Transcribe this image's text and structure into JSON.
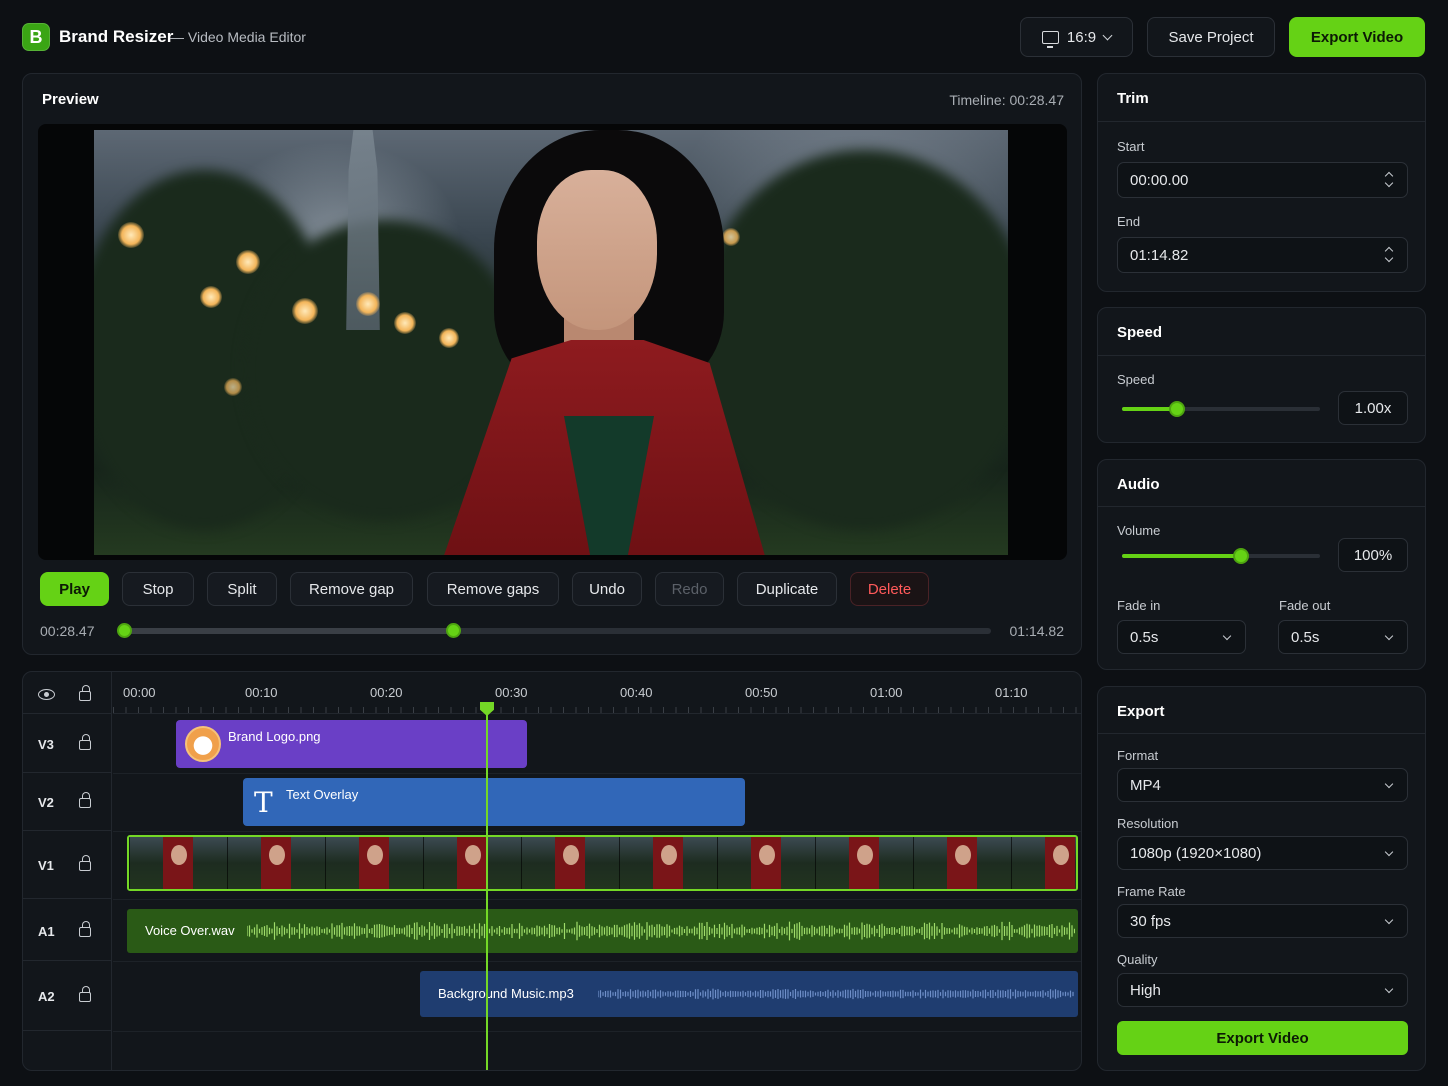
{
  "app": {
    "logo_letter": "B",
    "title": "Brand Resizer",
    "subtitle": "— Video Media Editor"
  },
  "header": {
    "aspect_ratio": "16:9",
    "save_label": "Save Project",
    "export_label": "Export Video"
  },
  "preview": {
    "title": "Preview",
    "timeline_readout": "Timeline: 00:28.47",
    "controls": [
      "Play",
      "Stop",
      "Split",
      "Remove gap",
      "Remove gaps",
      "Undo",
      "Redo",
      "Duplicate",
      "Delete"
    ],
    "scrubber": {
      "current": "00:28.47",
      "end": "01:14.82",
      "progress": 0.38
    }
  },
  "timeline": {
    "ruler": [
      "00:00",
      "00:10",
      "00:20",
      "00:30",
      "00:40",
      "00:50",
      "01:00",
      "01:10"
    ],
    "tracks": [
      "V3",
      "V2",
      "V1",
      "A1",
      "A2"
    ],
    "clips": {
      "v3": "Brand Logo.png",
      "v2": "Text Overlay",
      "a1": "Voice Over.wav",
      "a2": "Background Music.mp3"
    },
    "icons": {
      "visibility": "eye-icon",
      "lock": "lock-icon",
      "text": "text-icon"
    }
  },
  "trim": {
    "title": "Trim",
    "start_label": "Start",
    "start_value": "00:00.00",
    "end_label": "End",
    "end_value": "01:14.82"
  },
  "speed": {
    "title": "Speed",
    "label": "Speed",
    "value": "1.00x",
    "level": 0.28
  },
  "audio": {
    "title": "Audio",
    "volume_label": "Volume",
    "volume_value": "100%",
    "volume_level": 0.6,
    "fade_in_label": "Fade in",
    "fade_in_value": "0.5s",
    "fade_out_label": "Fade out",
    "fade_out_value": "0.5s"
  },
  "export": {
    "title": "Export",
    "format_label": "Format",
    "format_value": "MP4",
    "resolution_label": "Resolution",
    "resolution_value": "1080p (1920×1080)",
    "framerate_label": "Frame Rate",
    "framerate_value": "30 fps",
    "quality_label": "Quality",
    "quality_value": "High",
    "button_label": "Export Video"
  },
  "colors": {
    "accent": "#65d215",
    "delete": "#ff5a5a",
    "logo_clip": "#6a3fc6",
    "text_clip": "#3167b8",
    "voice_clip": "#2a5a16",
    "music_clip": "#1f3d70"
  }
}
